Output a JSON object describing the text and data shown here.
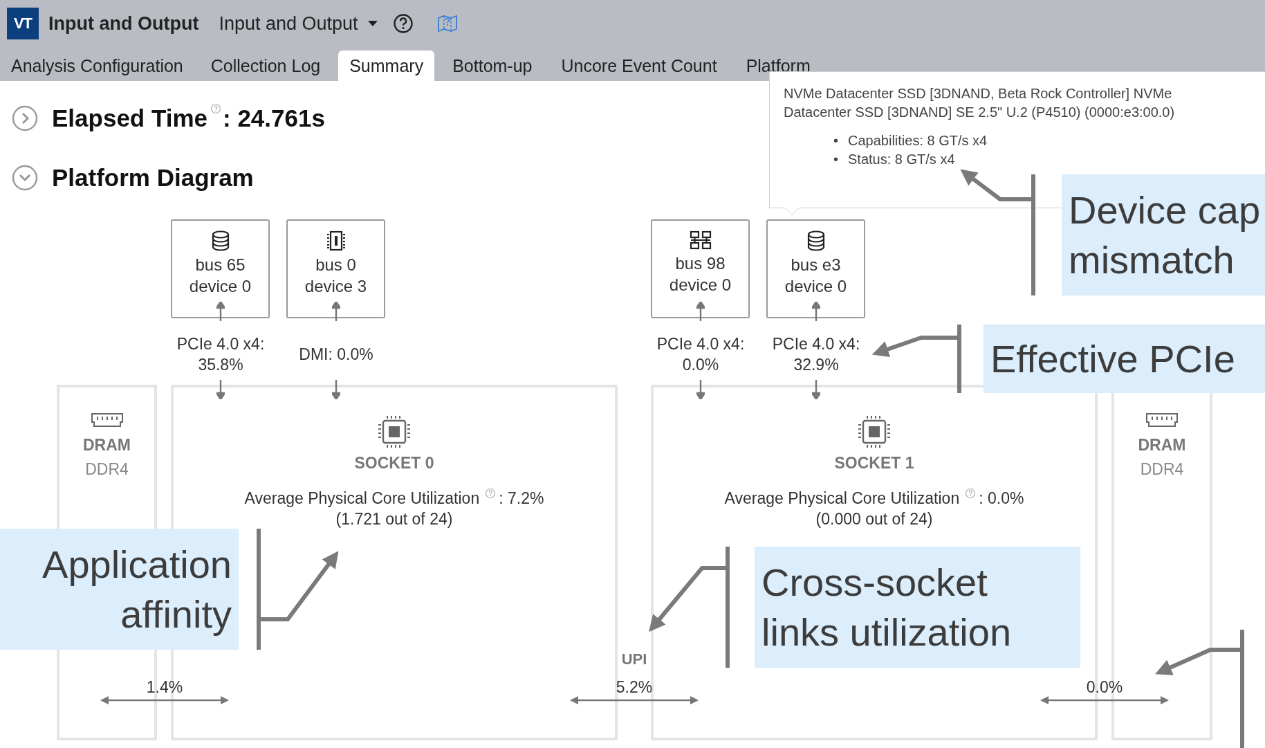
{
  "app": {
    "logo": "VT",
    "title": "Input and Output",
    "analysis": "Input and Output"
  },
  "tabs": [
    {
      "label": "Analysis Configuration",
      "selected": false
    },
    {
      "label": "Collection Log",
      "selected": false
    },
    {
      "label": "Summary",
      "selected": true
    },
    {
      "label": "Bottom-up",
      "selected": false
    },
    {
      "label": "Uncore Event Count",
      "selected": false
    },
    {
      "label": "Platform",
      "selected": false
    }
  ],
  "elapsed_time": {
    "label": "Elapsed Time",
    "value": ": 24.761s",
    "expanded": false
  },
  "platform_diagram": {
    "title": "Platform Diagram",
    "expanded": true,
    "devices": [
      {
        "kind": "storage",
        "bus": "bus 65",
        "device": "device 0",
        "link": "PCIe 4.0 x4:",
        "usage": "35.8%"
      },
      {
        "kind": "chip",
        "bus": "bus 0",
        "device": "device 3",
        "link": "DMI: 0.0%"
      },
      {
        "kind": "network",
        "bus": "bus 98",
        "device": "device 0",
        "link": "PCIe 4.0 x4:",
        "usage": "0.0%"
      },
      {
        "kind": "storage",
        "bus": "bus e3",
        "device": "device 0",
        "link": "PCIe 4.0 x4:",
        "usage": "32.9%"
      }
    ],
    "dram": [
      {
        "label": "DRAM",
        "type": "DDR4"
      },
      {
        "label": "DRAM",
        "type": "DDR4"
      }
    ],
    "sockets": [
      {
        "name": "SOCKET 0",
        "metric": "Average Physical Core Utilization",
        "value": ": 7.2%",
        "detail": "(1.721 out of 24)"
      },
      {
        "name": "SOCKET 1",
        "metric": "Average Physical Core Utilization",
        "value": ": 0.0%",
        "detail": "(0.000 out of 24)"
      }
    ],
    "links": [
      {
        "value": "1.4%"
      },
      {
        "name": "UPI",
        "value": "5.2%"
      },
      {
        "value": "0.0%"
      }
    ]
  },
  "tooltip": {
    "title": "NVMe Datacenter SSD [3DNAND, Beta Rock Controller] NVMe Datacenter SSD [3DNAND] SE 2.5\" U.2 (P4510) (0000:e3:00.0)",
    "items": [
      {
        "marker": "•",
        "text": "Capabilities: 8 GT/s x4"
      },
      {
        "marker": "•",
        "text": "Status: 8 GT/s x4"
      }
    ]
  },
  "callouts": [
    {
      "lines": [
        "Device cap",
        "mismatch"
      ]
    },
    {
      "lines": [
        "Effective PCIe"
      ]
    },
    {
      "lines": [
        "Application",
        "affinity"
      ]
    },
    {
      "lines": [
        "Cross-socket",
        "links utilization"
      ]
    }
  ]
}
